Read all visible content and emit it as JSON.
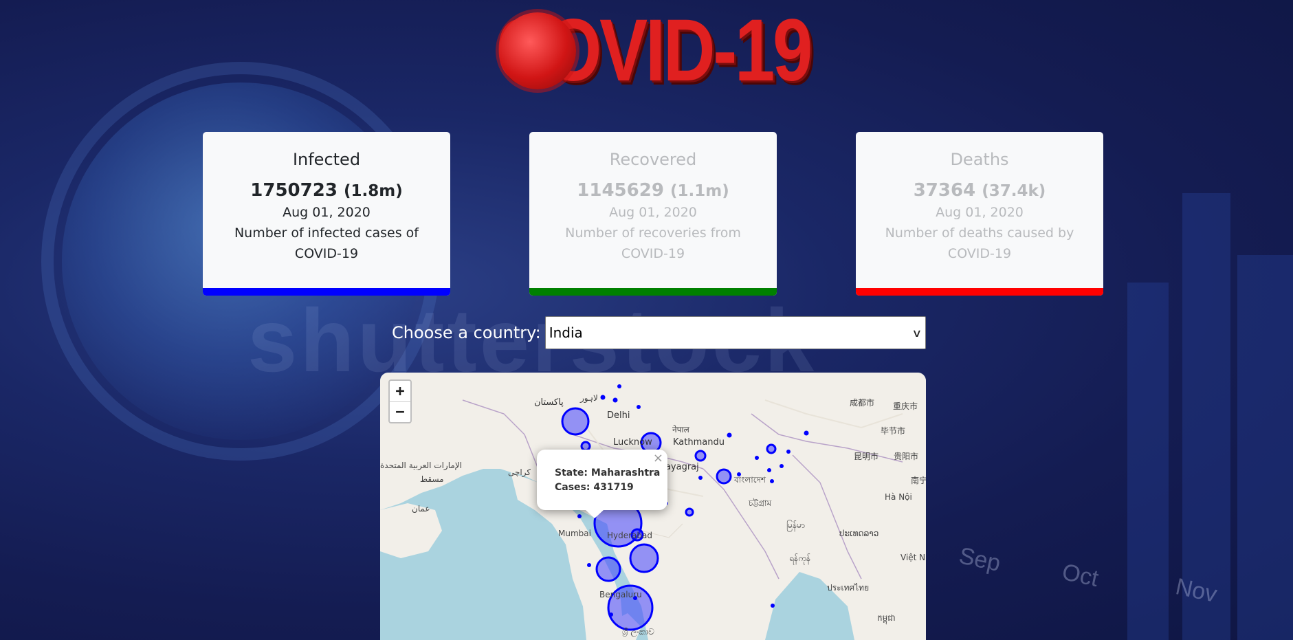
{
  "logo": {
    "text": "COVID-19"
  },
  "cards": [
    {
      "id": "infected",
      "title": "Infected",
      "value": "1750723",
      "short": "(1.8m)",
      "date": "Aug 01, 2020",
      "description": "Number of infected cases of COVID-19",
      "bar_color": "#0000ff",
      "active": true
    },
    {
      "id": "recovered",
      "title": "Recovered",
      "value": "1145629",
      "short": "(1.1m)",
      "date": "Aug 01, 2020",
      "description": "Number of recoveries from COVID-19",
      "bar_color": "#008000",
      "active": false
    },
    {
      "id": "deaths",
      "title": "Deaths",
      "value": "37364",
      "short": "(37.4k)",
      "date": "Aug 01, 2020",
      "description": "Number of deaths caused by COVID-19",
      "bar_color": "#ff0000",
      "active": false
    }
  ],
  "country_selector": {
    "label": "Choose a country:",
    "selected": "India"
  },
  "map": {
    "zoom_in": "+",
    "zoom_out": "−",
    "popup": {
      "state_line": "State: Maharashtra",
      "cases_line": "Cases: 431719",
      "close": "×"
    },
    "place_labels": {
      "lahore": "لاہور",
      "pakistan": "پاکستان",
      "delhi": "Delhi",
      "lucknow": "Lucknow",
      "kathmandu": "Kathmandu",
      "nepal": "नेपाल",
      "prayagraj": "Prayagraj",
      "chengdu": "成都市",
      "chongqing": "重庆市",
      "bijie": "毕节市",
      "kunming": "昆明市",
      "guiyang": "贵阳市",
      "nanning": "南宁",
      "uae": "الإمارات العربية المتحدة",
      "muscat": "مسقط",
      "karachi": "کراچی",
      "oman": "عمان",
      "bangladesh": "বাংলাদেশ",
      "chittagong": "চট্টগ্রাম",
      "myanmar": "မြန်မာ",
      "laos": "ປະເທດລາວ",
      "hanoi": "Hà Nội",
      "vietnam": "Việt N",
      "mumbai": "Mumbai",
      "hyderabad": "Hyderabad",
      "yangon": "ရန်ကုန်",
      "thailand": "ประเทศไทย",
      "bengaluru": "Bengaluru",
      "cambodia": "កម្ពុជា",
      "srilanka": "ශ්‍රී ලංකාව"
    }
  },
  "colors": {
    "marker": "#0000ff",
    "marker_fill": "rgba(51,51,255,0.5)"
  }
}
